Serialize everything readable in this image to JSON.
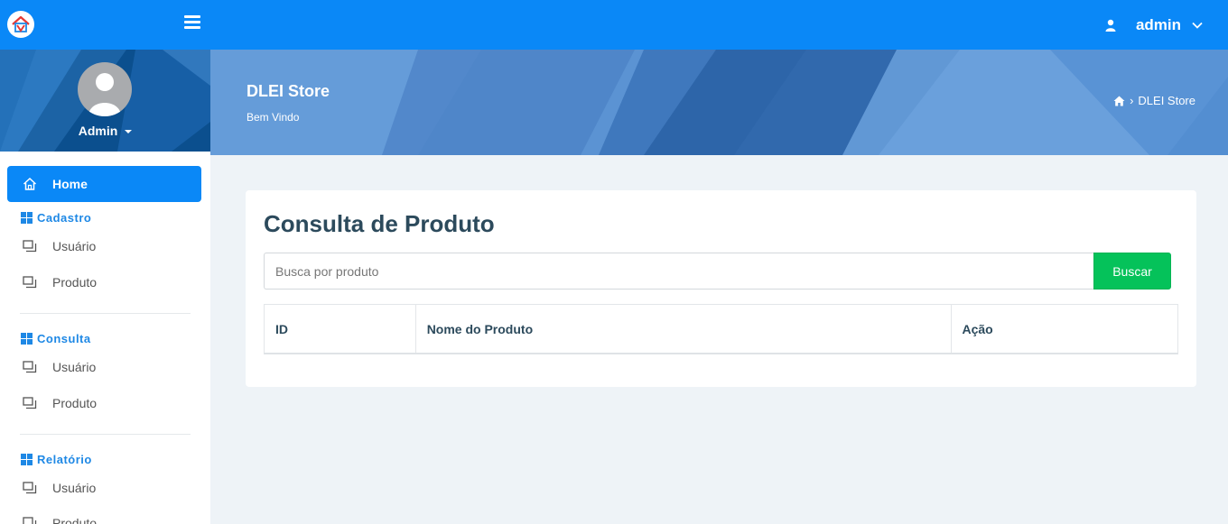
{
  "topbar": {
    "user_name": "admin",
    "colors": {
      "bar": "#0a88f7"
    }
  },
  "sidebar": {
    "profile_name": "Admin",
    "home_label": "Home",
    "sections": [
      {
        "title": "Cadastro",
        "items": [
          "Usuário",
          "Produto"
        ]
      },
      {
        "title": "Consulta",
        "items": [
          "Usuário",
          "Produto"
        ]
      },
      {
        "title": "Relatório",
        "items": [
          "Usuário",
          "Produto"
        ]
      }
    ]
  },
  "header": {
    "title": "DLEI Store",
    "subtitle": "Bem Vindo",
    "breadcrumb": "DLEI Store"
  },
  "main": {
    "title": "Consulta de Produto",
    "search_placeholder": "Busca por produto",
    "search_button": "Buscar",
    "table": {
      "columns": [
        "ID",
        "Nome do Produto",
        "Ação"
      ]
    }
  },
  "colors": {
    "accent": "#0a88f7",
    "success": "#05c25a",
    "section_title": "#1e88e5"
  }
}
